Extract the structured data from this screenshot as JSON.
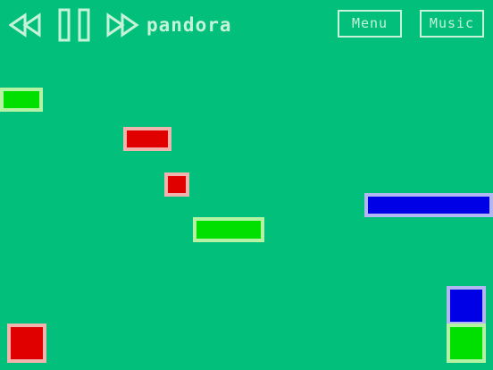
{
  "header": {
    "title": "pandora",
    "menu_label": "Menu",
    "music_label": "Music"
  },
  "controls": {
    "rewind_icon": "rewind-icon",
    "pause_icon": "pause-icon",
    "fast_forward_icon": "fast-forward-icon"
  },
  "colors": {
    "background": "#02c07b",
    "ui_accent": "#c6f2d7",
    "green_block": "#00e000",
    "red_block": "#e00000",
    "blue_block": "#0000e6"
  },
  "blocks": [
    {
      "color": "green"
    },
    {
      "color": "red"
    },
    {
      "color": "red"
    },
    {
      "color": "green"
    },
    {
      "color": "blue"
    },
    {
      "color": "blue"
    },
    {
      "color": "green"
    },
    {
      "color": "red"
    }
  ]
}
